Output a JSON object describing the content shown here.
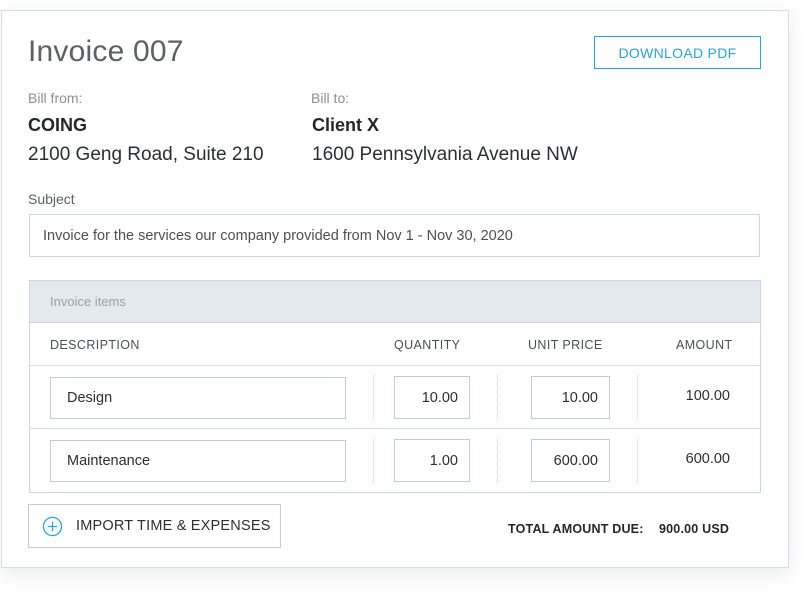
{
  "invoice": {
    "title": "Invoice 007",
    "download_label": "DOWNLOAD PDF"
  },
  "bill_from": {
    "label": "Bill from:",
    "name": "COING",
    "address": "2100 Geng Road, Suite 210"
  },
  "bill_to": {
    "label": "Bill to:",
    "name": "Client X",
    "address": "1600 Pennsylvania Avenue NW"
  },
  "subject": {
    "label": "Subject",
    "value": "Invoice for the services our company provided from Nov 1 - Nov 30, 2020"
  },
  "items": {
    "header": "Invoice items",
    "columns": {
      "description": "DESCRIPTION",
      "quantity": "QUANTITY",
      "unit_price": "UNIT PRICE",
      "amount": "AMOUNT"
    },
    "rows": [
      {
        "description": "Design",
        "quantity": "10.00",
        "unit_price": "10.00",
        "amount": "100.00"
      },
      {
        "description": "Maintenance",
        "quantity": "1.00",
        "unit_price": "600.00",
        "amount": "600.00"
      }
    ]
  },
  "footer": {
    "import_label": "IMPORT TIME & EXPENSES",
    "import_icon": "plus-circle-icon",
    "total_label": "TOTAL AMOUNT DUE:",
    "total_value": "900.00 USD"
  },
  "colors": {
    "accent": "#2aa3d8",
    "header_bg": "#e3e9ee",
    "border": "#cfd6dc"
  }
}
